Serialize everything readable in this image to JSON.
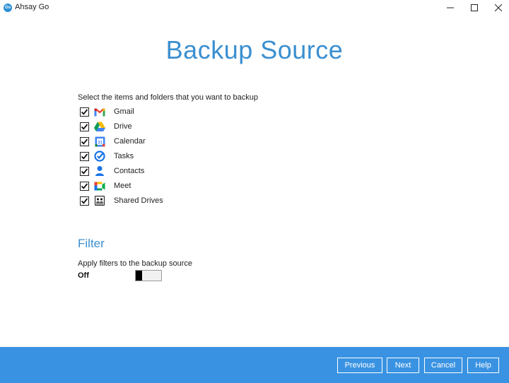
{
  "window": {
    "app_title": "Ahsay Go",
    "app_icon_text": "Go"
  },
  "page": {
    "heading": "Backup Source",
    "instructions": "Select the items and folders that you want to backup"
  },
  "items": [
    {
      "label": "Gmail",
      "checked": true,
      "icon": "gmail-icon"
    },
    {
      "label": "Drive",
      "checked": true,
      "icon": "drive-icon"
    },
    {
      "label": "Calendar",
      "checked": true,
      "icon": "calendar-icon"
    },
    {
      "label": "Tasks",
      "checked": true,
      "icon": "tasks-icon"
    },
    {
      "label": "Contacts",
      "checked": true,
      "icon": "contacts-icon"
    },
    {
      "label": "Meet",
      "checked": true,
      "icon": "meet-icon"
    },
    {
      "label": "Shared Drives",
      "checked": true,
      "icon": "shared-drives-icon"
    }
  ],
  "filter": {
    "heading": "Filter",
    "description": "Apply filters to the backup source",
    "state": "Off"
  },
  "footer": {
    "previous_label": "Previous",
    "next_label": "Next",
    "cancel_label": "Cancel",
    "help_label": "Help"
  },
  "colors": {
    "accent": "#3b8fd0",
    "footer_bg": "#3a93e2"
  }
}
